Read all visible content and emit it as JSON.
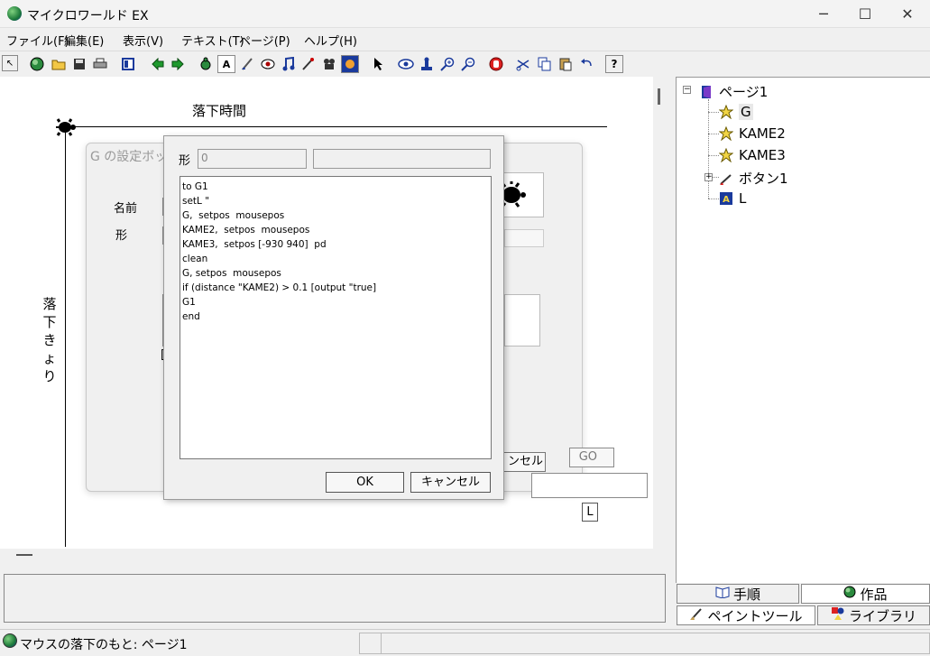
{
  "window": {
    "title": "マイクロワールド EX",
    "minimize": "─",
    "maximize": "☐",
    "close": "✕"
  },
  "menu": [
    "ファイル(F)",
    "編集(E)",
    "表示(V)",
    "テキスト(T)",
    "ページ(P)",
    "ヘルプ(H)"
  ],
  "toolbar_glyphs": {
    "text_tool": "A",
    "label_tool": "A",
    "help": "?"
  },
  "canvas": {
    "time_label": "落下時間",
    "distance_label": "落下きょり",
    "go_button": "GO",
    "l_button": "L"
  },
  "settings_dialog": {
    "title": "G の設定ボッ",
    "name_label": "名前",
    "shape_label": "形",
    "cancel_partial": "ンセル",
    "bracket": "["
  },
  "code_dialog": {
    "shape_label": "形",
    "shape_value": "0",
    "code_lines": [
      "to G1",
      "setL \"",
      "G,  setpos  mousepos",
      "KAME2,  setpos  mousepos",
      "KAME3,  setpos [-930 940]  pd",
      "clean",
      "G, setpos  mousepos",
      "if (distance \"KAME2) > 0.1 [output \"true]",
      "G1",
      "end"
    ],
    "ok_label": "OK",
    "cancel_label": "キャンセル"
  },
  "tree": {
    "root": "ページ1",
    "items": [
      "G",
      "KAME2",
      "KAME3",
      "ボタン1",
      "L"
    ]
  },
  "tabs": {
    "procedures": "手順",
    "works": "作品",
    "paint_tool": "ペイントツール",
    "library": "ライブラリ"
  },
  "status": {
    "text": "マウスの落下のもと: ページ1"
  },
  "colors": {
    "canvas_bg": "#ffffff",
    "chrome_bg": "#f0f0f0",
    "accent_blue": "#1a3a9c"
  }
}
